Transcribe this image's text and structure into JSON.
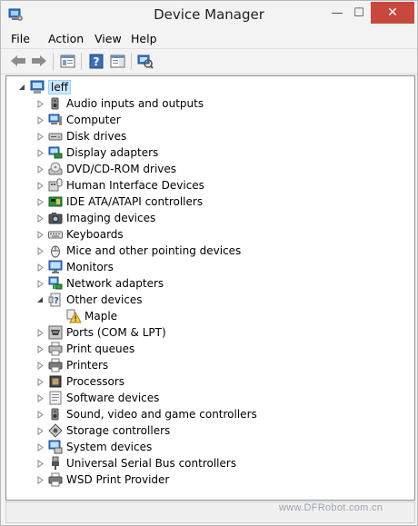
{
  "window": {
    "title": "Device Manager",
    "close_glyph": "✕",
    "maximize_glyph": "☐",
    "minimize_glyph": "—"
  },
  "menu": [
    "File",
    "Action",
    "View",
    "Help"
  ],
  "toolbar": [
    "back-arrow-icon",
    "forward-arrow-icon",
    "properties-icon",
    "help-icon",
    "action-pane-icon",
    "scan-hardware-icon"
  ],
  "tree": {
    "root": "leff",
    "categories": [
      {
        "label": "Audio inputs and outputs",
        "icon": "speaker-icon",
        "expanded": false
      },
      {
        "label": "Computer",
        "icon": "computer-icon",
        "expanded": false
      },
      {
        "label": "Disk drives",
        "icon": "disk-drive-icon",
        "expanded": false
      },
      {
        "label": "Display adapters",
        "icon": "display-adapter-icon",
        "expanded": false
      },
      {
        "label": "DVD/CD-ROM drives",
        "icon": "dvd-drive-icon",
        "expanded": false
      },
      {
        "label": "Human Interface Devices",
        "icon": "hid-icon",
        "expanded": false
      },
      {
        "label": "IDE ATA/ATAPI controllers",
        "icon": "ide-controller-icon",
        "expanded": false
      },
      {
        "label": "Imaging devices",
        "icon": "camera-icon",
        "expanded": false
      },
      {
        "label": "Keyboards",
        "icon": "keyboard-icon",
        "expanded": false
      },
      {
        "label": "Mice and other pointing devices",
        "icon": "mouse-icon",
        "expanded": false
      },
      {
        "label": "Monitors",
        "icon": "monitor-icon",
        "expanded": false
      },
      {
        "label": "Network adapters",
        "icon": "network-adapter-icon",
        "expanded": false
      },
      {
        "label": "Other devices",
        "icon": "unknown-device-icon",
        "expanded": true,
        "children": [
          {
            "label": "Maple",
            "icon": "warning-device-icon"
          }
        ]
      },
      {
        "label": "Ports (COM & LPT)",
        "icon": "port-icon",
        "expanded": false
      },
      {
        "label": "Print queues",
        "icon": "print-queue-icon",
        "expanded": false
      },
      {
        "label": "Printers",
        "icon": "printer-icon",
        "expanded": false
      },
      {
        "label": "Processors",
        "icon": "processor-icon",
        "expanded": false
      },
      {
        "label": "Software devices",
        "icon": "software-device-icon",
        "expanded": false
      },
      {
        "label": "Sound, video and game controllers",
        "icon": "speaker-icon",
        "expanded": false
      },
      {
        "label": "Storage controllers",
        "icon": "storage-controller-icon",
        "expanded": false
      },
      {
        "label": "System devices",
        "icon": "system-device-icon",
        "expanded": false
      },
      {
        "label": "Universal Serial Bus controllers",
        "icon": "usb-icon",
        "expanded": false
      },
      {
        "label": "WSD Print Provider",
        "icon": "printer-icon",
        "expanded": false
      }
    ]
  },
  "watermark": "www.DFRobot.com.cn",
  "colors": {
    "close_button": "#c8483d",
    "selection": "#cce8ff",
    "selection_border": "#99d1ff"
  }
}
